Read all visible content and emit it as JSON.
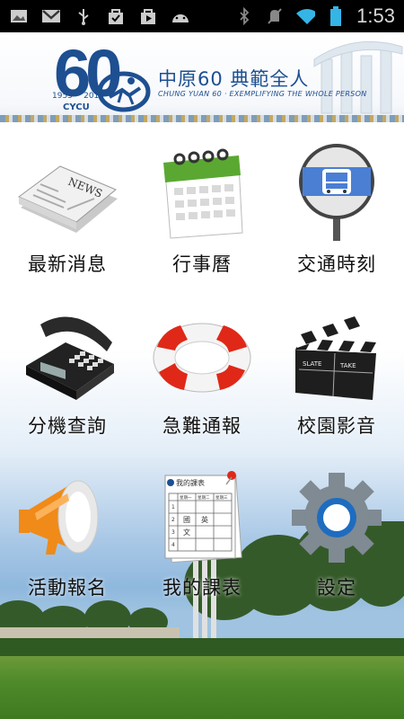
{
  "status_bar": {
    "time": "1:53",
    "left_icons": [
      "image-icon",
      "gmail-icon",
      "usb-icon",
      "bag-icon",
      "play-store-icon",
      "android-icon"
    ],
    "right_icons": [
      "bluetooth-icon",
      "mute-icon",
      "wifi-icon",
      "battery-icon"
    ]
  },
  "header": {
    "logo_number": "60",
    "year_start": "1955",
    "year_end": "2015",
    "logo_abbrev": "CYCU",
    "title": "中原60  典範全人",
    "subtitle": "CHUNG YUAN 60 · EXEMPLIFYING THE WHOLE PERSON"
  },
  "menu": [
    {
      "label": "最新消息",
      "icon": "newspaper-icon"
    },
    {
      "label": "行事曆",
      "icon": "calendar-icon"
    },
    {
      "label": "交通時刻",
      "icon": "bus-sign-icon"
    },
    {
      "label": "分機查詢",
      "icon": "telephone-icon"
    },
    {
      "label": "急難通報",
      "icon": "lifebuoy-icon"
    },
    {
      "label": "校園影音",
      "icon": "clapperboard-icon"
    },
    {
      "label": "活動報名",
      "icon": "megaphone-icon"
    },
    {
      "label": "我的課表",
      "icon": "timetable-icon"
    },
    {
      "label": "設定",
      "icon": "gear-icon"
    }
  ],
  "timetable_icon_text": {
    "title": "我的課表",
    "col_headers": [
      "星期一",
      "星期二",
      "星期三"
    ],
    "row_numbers": [
      "1",
      "2",
      "3",
      "4"
    ],
    "cells": [
      "國",
      "文",
      "英"
    ]
  },
  "newspaper_icon_text": "NEWS",
  "clapper_text": [
    "SLATE",
    "TAKE"
  ],
  "colors": {
    "brand_blue": "#1d4f91",
    "status_bar": "#000000"
  }
}
